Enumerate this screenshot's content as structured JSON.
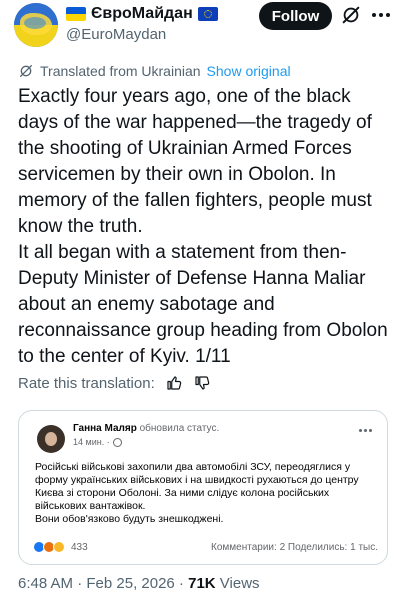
{
  "author": {
    "name": "ЄвроМайдан",
    "handle": "@EuroMaydan"
  },
  "follow_label": "Follow",
  "translation": {
    "note": "Translated from Ukrainian",
    "show_original": "Show original"
  },
  "tweet": {
    "paragraph1": "Exactly four years ago, one of the black days of the war happened—the tragedy of the shooting of Ukrainian Armed Forces servicemen by their own in Obolon. In memory of the fallen fighters, people must know the truth.",
    "paragraph2": "It all began with a statement from then-Deputy Minister of Defense Hanna Maliar about an enemy sabotage and reconnaissance group heading from Obolon to the center of Kyiv. 1/11"
  },
  "rate_label": "Rate this translation:",
  "embedded_post": {
    "name": "Ганна Маляр",
    "action": "обновила статус.",
    "time": "14 мин. ·",
    "text1": "Російські військові захопили два автомобілі ЗСУ, переодяглися у форму українських військових і на швидкості рухаються до центру Києва зі сторони Оболоні. За ними слідує колона російських військових вантажівок.",
    "text2": "Вони обов'язково будуть знешкоджені.",
    "reactions_count": "433",
    "stats": "Комментарии: 2  Поделились: 1 тыс."
  },
  "meta": {
    "timestamp": "6:48 AM · Feb 25, 2026 · ",
    "views_count": "71K",
    "views_label": " Views"
  },
  "colors": {
    "accent": "#1d9bf0",
    "text": "#0f1419",
    "secondary": "#536471",
    "border": "#cfd9de"
  }
}
